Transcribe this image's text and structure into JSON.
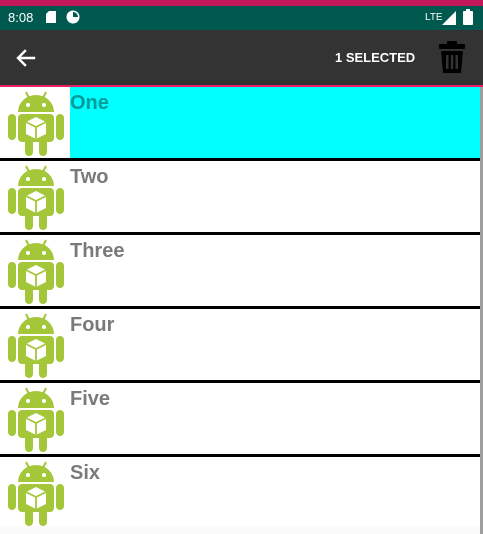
{
  "status_bar": {
    "time": "8:08",
    "network": "LTE",
    "icons": [
      "sd-card-icon",
      "app-notification-icon",
      "signal-icon",
      "battery-icon"
    ]
  },
  "app_bar": {
    "back_icon": "arrow-back-icon",
    "title": "1 SELECTED",
    "delete_icon": "trash-icon"
  },
  "colors": {
    "status_bar": "#00594f",
    "app_bar": "#333333",
    "selected_row": "#00ffff",
    "accent_line": "#e91e63",
    "android_green": "#a4c639"
  },
  "list": {
    "items": [
      {
        "label": "One",
        "selected": true,
        "icon": "android-icon"
      },
      {
        "label": "Two",
        "selected": false,
        "icon": "android-icon"
      },
      {
        "label": "Three",
        "selected": false,
        "icon": "android-icon"
      },
      {
        "label": "Four",
        "selected": false,
        "icon": "android-icon"
      },
      {
        "label": "Five",
        "selected": false,
        "icon": "android-icon"
      },
      {
        "label": "Six",
        "selected": false,
        "icon": "android-icon"
      }
    ]
  }
}
